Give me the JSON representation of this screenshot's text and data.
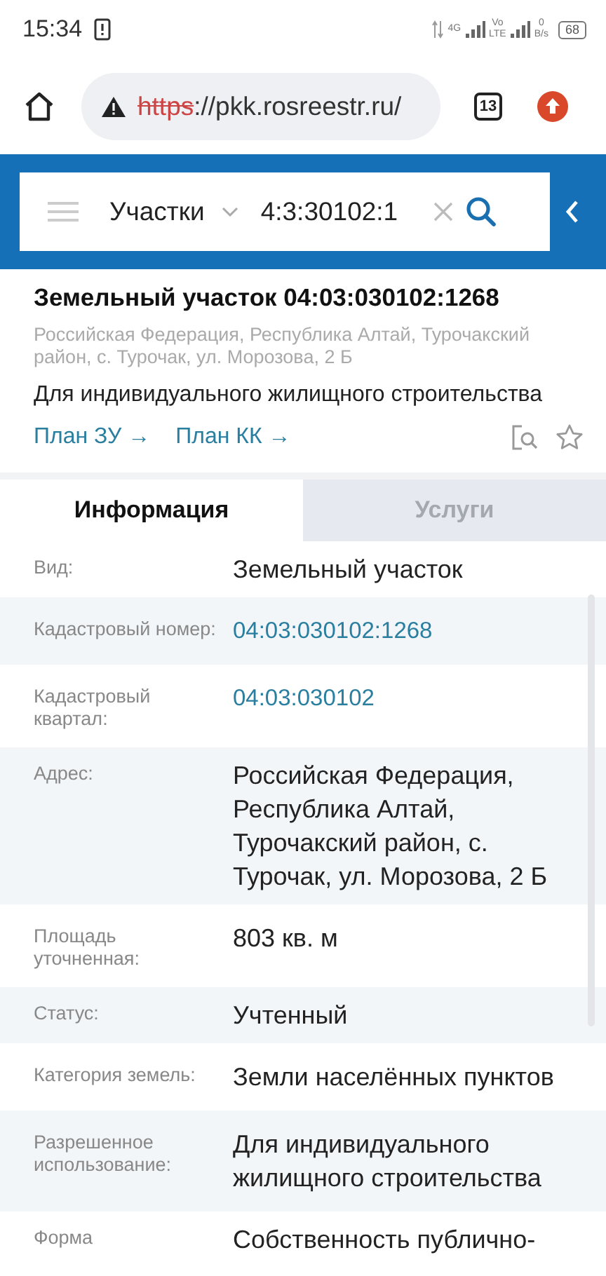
{
  "status_bar": {
    "time": "15:34",
    "network_1": "4G",
    "network_2_top": "Vo",
    "network_2_bottom": "LTE",
    "speed_value": "0",
    "speed_unit": "B/s",
    "battery": "68"
  },
  "browser": {
    "url_scheme": "https",
    "url_rest": "://pkk.rosreestr.ru/",
    "tab_count": "13"
  },
  "search": {
    "layer": "Участки",
    "value": "4:3:30102:1"
  },
  "card": {
    "title": "Земельный участок 04:03:030102:1268",
    "address": "Российская Федерация, Республика Алтай, Турочакский район, с. Турочак, ул. Морозова, 2 Б",
    "purpose": "Для индивидуального жилищного строительства",
    "links": [
      "План ЗУ →",
      "План КК →"
    ],
    "favorite": false
  },
  "tabs": [
    {
      "label": "Информация",
      "selected": true
    },
    {
      "label": "Услуги",
      "selected": false
    }
  ],
  "rows": [
    {
      "label": "Вид:",
      "value": "Земельный участок",
      "kind": "text"
    },
    {
      "label": "Кадастровый номер:",
      "value": "04:03:030102:1268",
      "kind": "link"
    },
    {
      "label": "Кадастровый квартал:",
      "value": "04:03:030102",
      "kind": "link"
    },
    {
      "label": "Адрес:",
      "value": "Российская Федерация, Республика Алтай, Турочакский район, с. Турочак, ул. Морозова, 2 Б",
      "kind": "text"
    },
    {
      "label": "Площадь уточненная:",
      "value": "803 кв. м",
      "kind": "text"
    },
    {
      "label": "Статус:",
      "value": "Учтенный",
      "kind": "text"
    },
    {
      "label": "Категория земель:",
      "value": "Земли населённых пунктов",
      "kind": "text"
    },
    {
      "label": "Разрешенное использование:",
      "value": "Для индивидуального жилищного строительства",
      "kind": "text"
    },
    {
      "label": "Форма",
      "value": "Собственность публично-",
      "kind": "text"
    }
  ]
}
